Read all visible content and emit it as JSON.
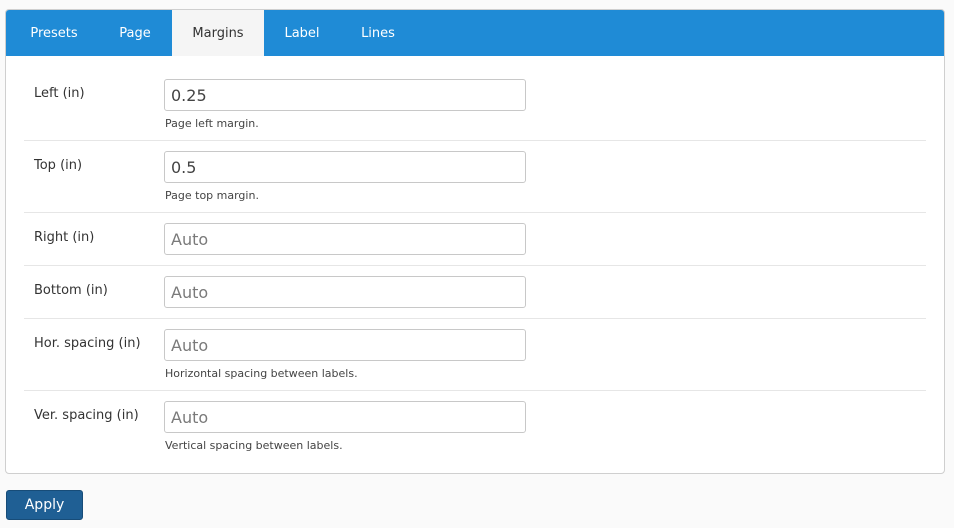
{
  "tabs": [
    {
      "label": "Presets",
      "active": false
    },
    {
      "label": "Page",
      "active": false
    },
    {
      "label": "Margins",
      "active": true
    },
    {
      "label": "Label",
      "active": false
    },
    {
      "label": "Lines",
      "active": false
    }
  ],
  "fields": [
    {
      "label": "Left (in)",
      "value": "0.25",
      "placeholder": "Auto",
      "help": "Page left margin."
    },
    {
      "label": "Top (in)",
      "value": "0.5",
      "placeholder": "Auto",
      "help": "Page top margin."
    },
    {
      "label": "Right (in)",
      "value": "",
      "placeholder": "Auto",
      "help": ""
    },
    {
      "label": "Bottom (in)",
      "value": "",
      "placeholder": "Auto",
      "help": ""
    },
    {
      "label": "Hor. spacing (in)",
      "value": "",
      "placeholder": "Auto",
      "help": "Horizontal spacing between labels."
    },
    {
      "label": "Ver. spacing (in)",
      "value": "",
      "placeholder": "Auto",
      "help": "Vertical spacing between labels."
    }
  ],
  "apply_label": "Apply",
  "colors": {
    "tabbar": "#1f8bd6",
    "active_tab_bg": "#f5f5f5",
    "apply_button": "#1f5f94"
  }
}
